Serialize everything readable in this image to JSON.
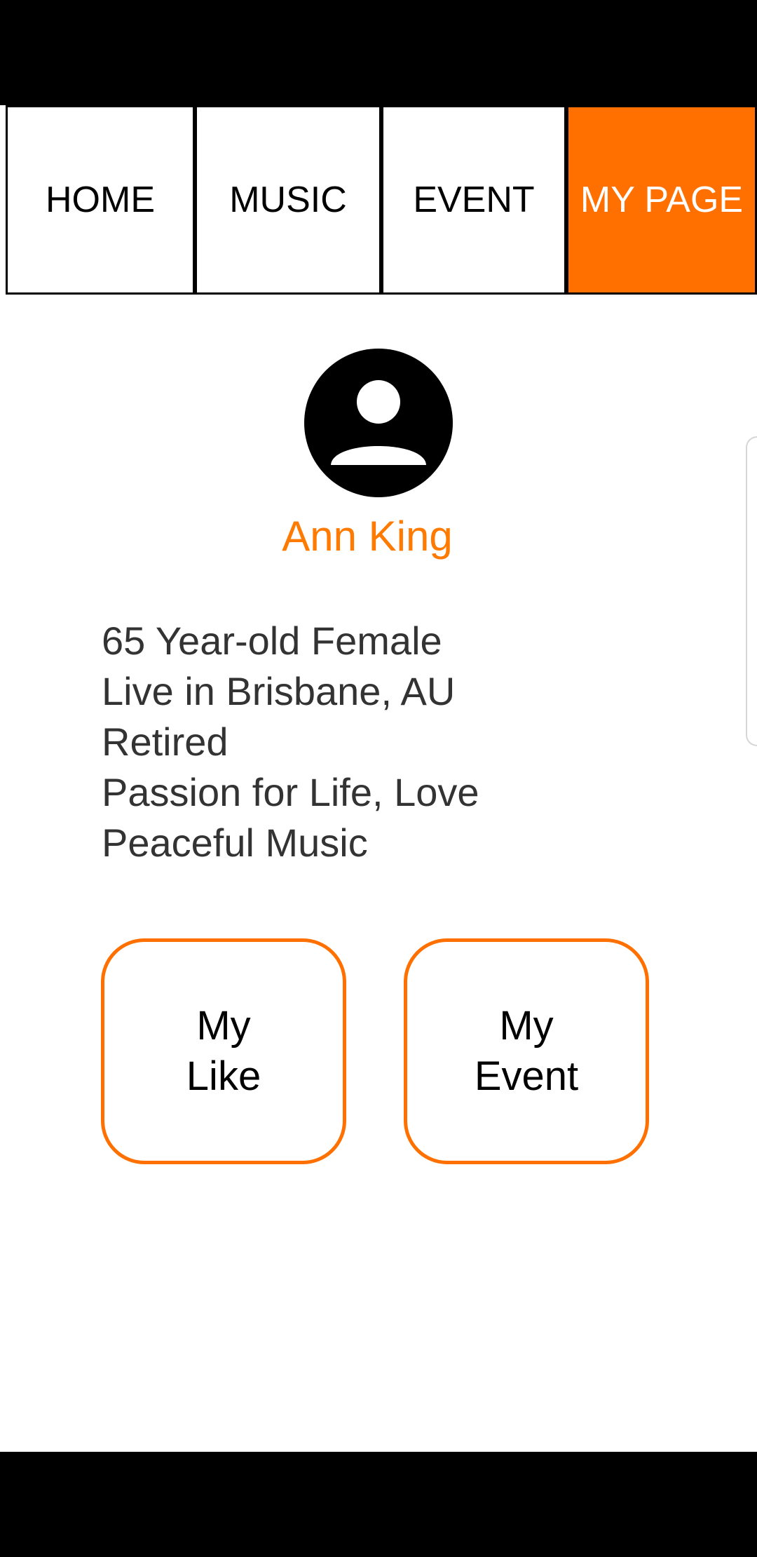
{
  "tabs": [
    {
      "label": "HOME",
      "active": false
    },
    {
      "label": "MUSIC",
      "active": false
    },
    {
      "label": "EVENT",
      "active": false
    },
    {
      "label": "MY PAGE",
      "active": true
    }
  ],
  "profile": {
    "avatar_icon": "account-circle-icon",
    "name": "Ann King",
    "bio": [
      "65 Year-old Female",
      "Live in Brisbane, AU",
      "Retired",
      "Passion for Life, Love",
      "Peaceful Music"
    ]
  },
  "actions": {
    "my_like": {
      "line1": "My",
      "line2": "Like"
    },
    "my_event": {
      "line1": "My",
      "line2": "Event"
    }
  },
  "colors": {
    "accent": "#ff7000",
    "name_text": "#ff7a00",
    "body_text": "#333333",
    "system_bars": "#000000"
  }
}
